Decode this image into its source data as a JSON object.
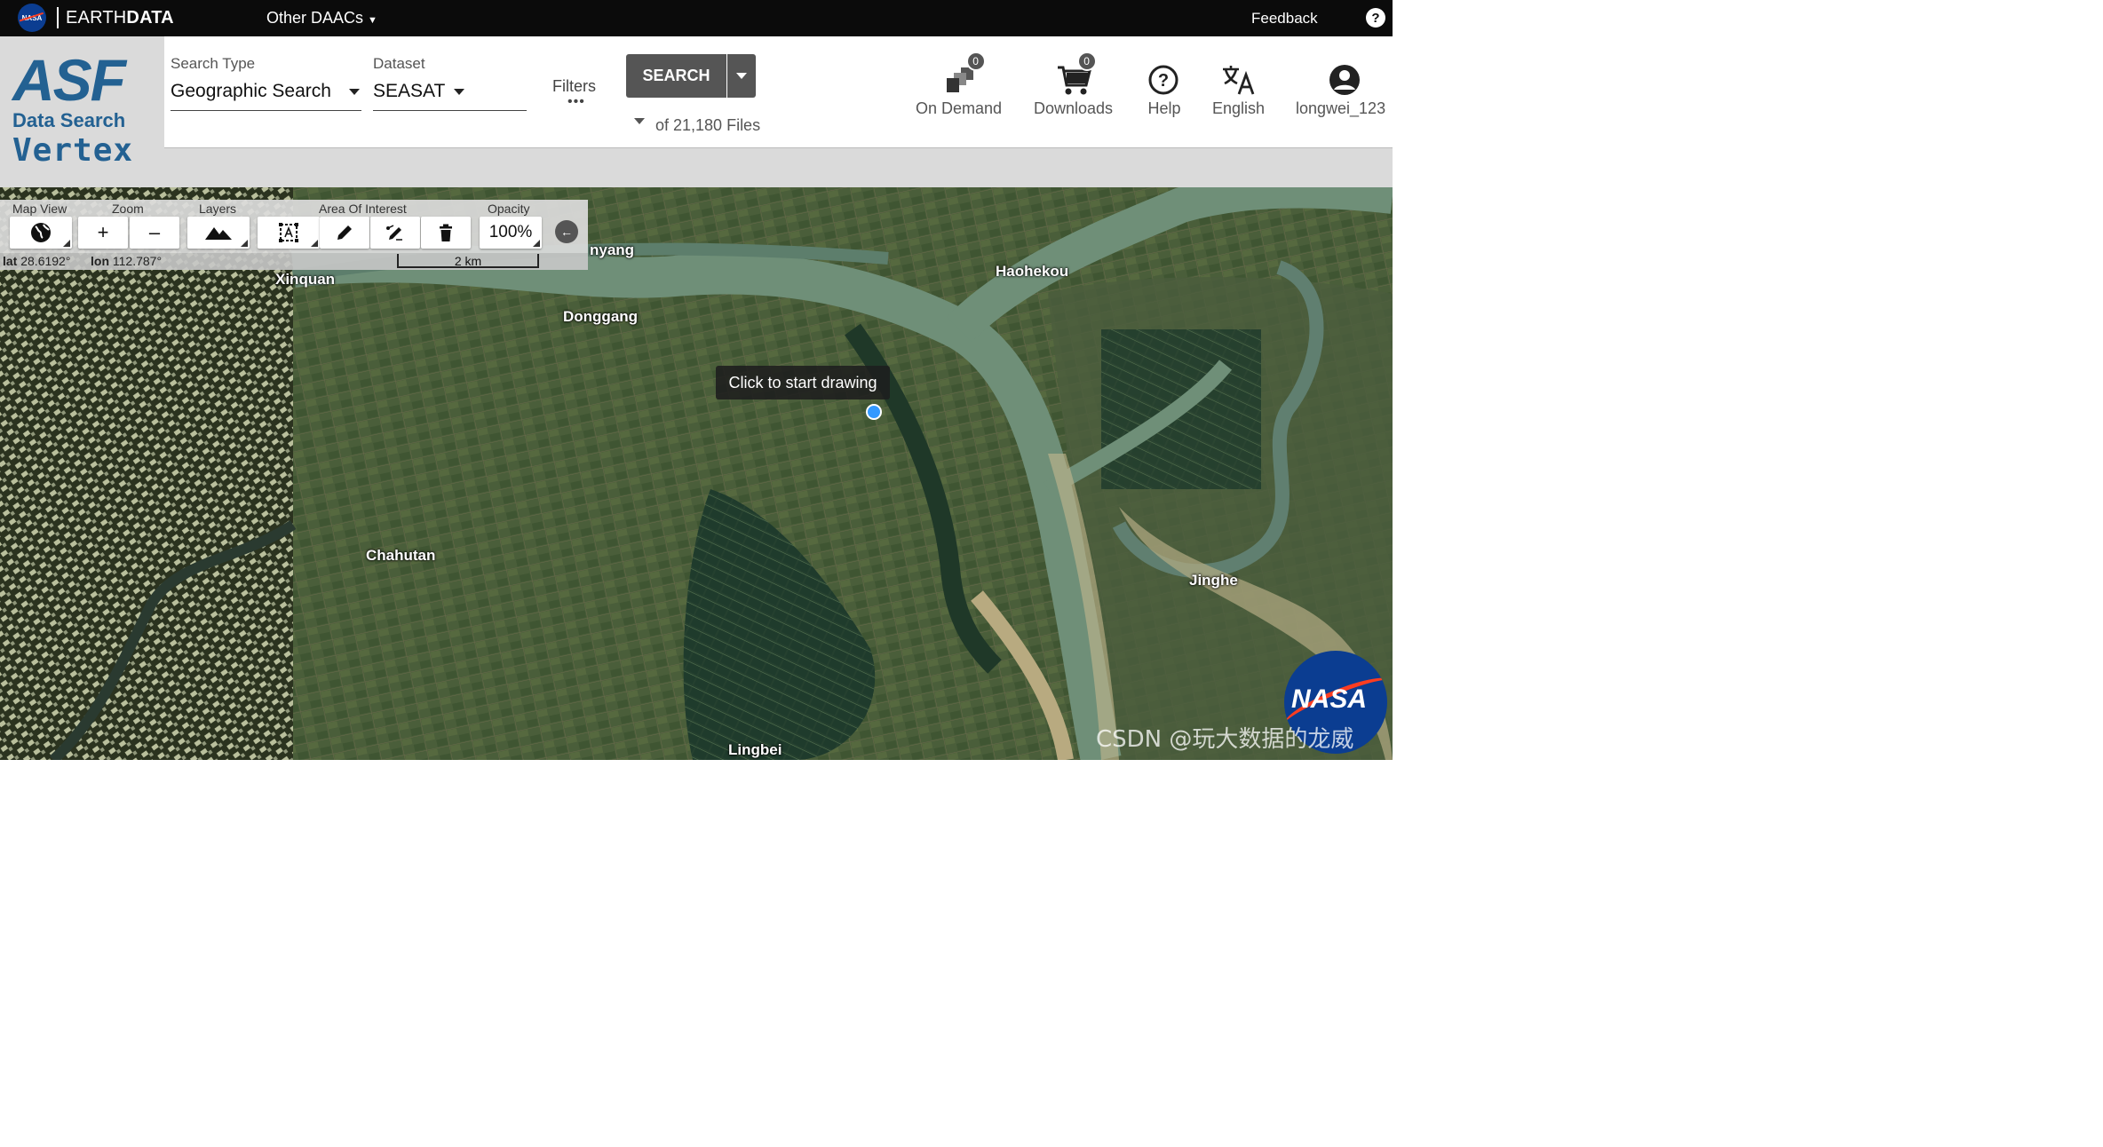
{
  "topbar": {
    "nasa_logo_text": "NASA",
    "brand_light": "EARTH",
    "brand_bold": "DATA",
    "other_daacs": "Other DAACs",
    "feedback": "Feedback",
    "help_symbol": "?"
  },
  "logo": {
    "asf": "ASF",
    "data_search": "Data Search",
    "vertex": "Vertex"
  },
  "search": {
    "search_type_label": "Search Type",
    "search_type_value": "Geographic Search",
    "dataset_label": "Dataset",
    "dataset_value": "SEASAT",
    "filters_label": "Filters",
    "filters_dots": "•••",
    "search_button": "SEARCH",
    "files_count": "of 21,180 Files"
  },
  "actions": {
    "on_demand": {
      "label": "On Demand",
      "badge": "0",
      "icon": "on-demand-icon"
    },
    "downloads": {
      "label": "Downloads",
      "badge": "0",
      "icon": "cart-icon"
    },
    "help": {
      "label": "Help",
      "icon": "help-circle-icon"
    },
    "language": {
      "label": "English",
      "icon": "translate-icon"
    },
    "user": {
      "label": "longwei_123",
      "icon": "account-icon"
    }
  },
  "map_toolbar": {
    "map_view_label": "Map View",
    "zoom_label": "Zoom",
    "layers_label": "Layers",
    "aoi_label": "Area Of Interest",
    "opacity_label": "Opacity",
    "zoom_in": "+",
    "zoom_out": "–",
    "opacity_value": "100%"
  },
  "coords": {
    "lat_label": "lat",
    "lat_value": "28.6192°",
    "lon_label": "lon",
    "lon_value": "112.787°",
    "scale": "2 km"
  },
  "map": {
    "places": {
      "nyang": "nyang",
      "xinquan": "Xinquan",
      "donggang": "Donggang",
      "haohekou": "Haohekou",
      "chahutan": "Chahutan",
      "jinghe": "Jinghe",
      "lingbei": "Lingbei"
    },
    "tooltip": "Click to start drawing"
  },
  "corner_logo_text": "NASA",
  "watermark": "CSDN @玩大数据的龙威",
  "colors": {
    "topbar": "#0b0b0b",
    "header_gray": "#dadada",
    "asf_blue": "#236192",
    "button_gray": "#555555",
    "draw_point": "#3399ff"
  }
}
